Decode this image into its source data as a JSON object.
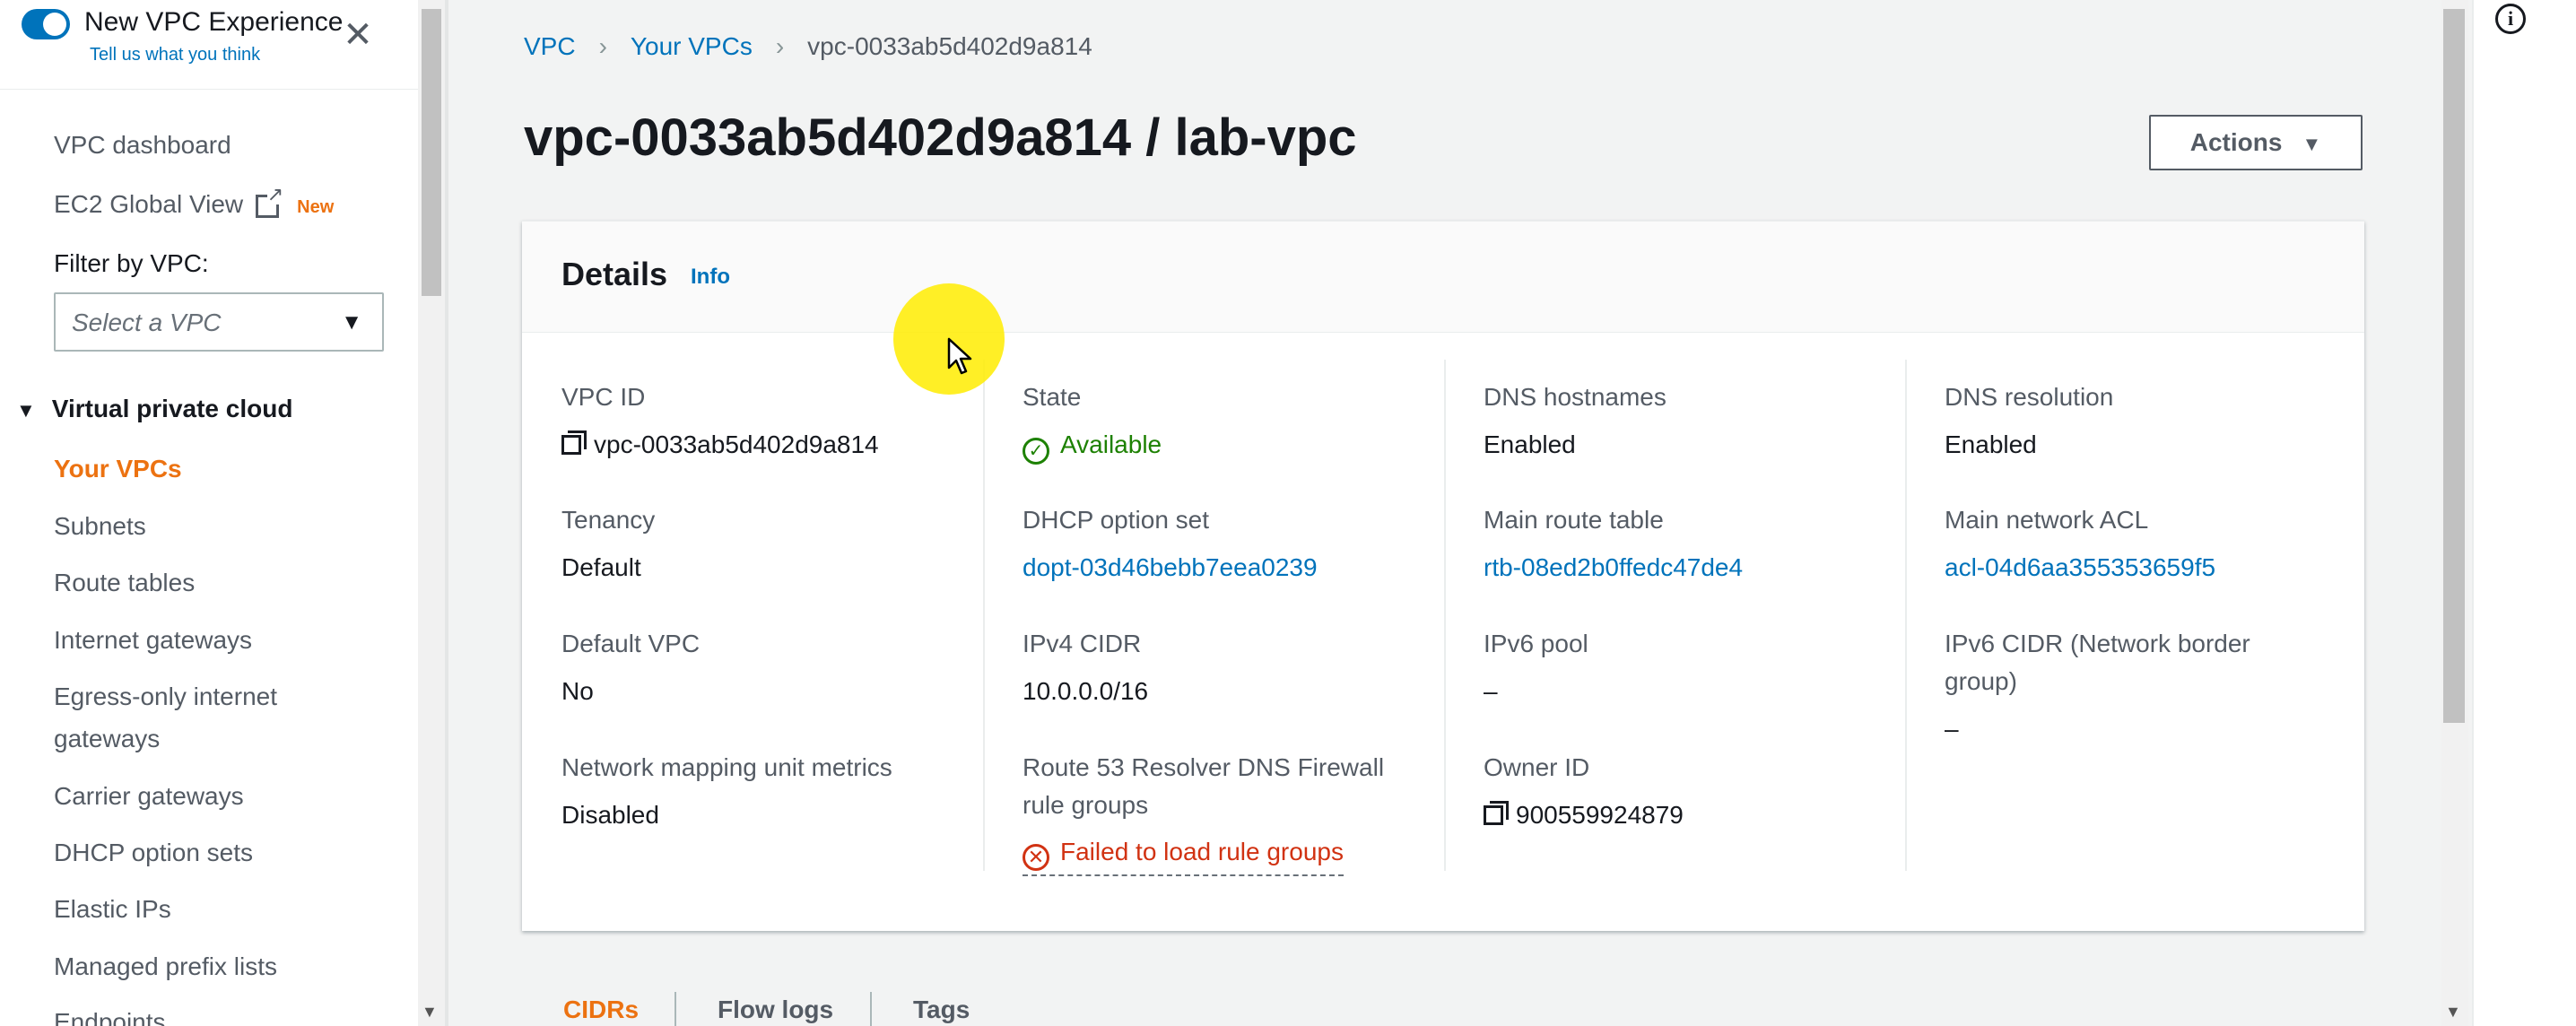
{
  "sidebar": {
    "experience_title": "New VPC Experience",
    "experience_sub": "Tell us what you think",
    "links": [
      {
        "label": "VPC dashboard"
      },
      {
        "label": "EC2 Global View",
        "badge": "New"
      }
    ],
    "filter_label": "Filter by VPC:",
    "filter_placeholder": "Select a VPC",
    "section": "Virtual private cloud",
    "items": [
      "Your VPCs",
      "Subnets",
      "Route tables",
      "Internet gateways",
      "Egress-only internet",
      "gateways",
      "Carrier gateways",
      "DHCP option sets",
      "Elastic IPs",
      "Managed prefix lists",
      "Endpoints"
    ]
  },
  "breadcrumb": [
    "VPC",
    "Your VPCs",
    "vpc-0033ab5d402d9a814"
  ],
  "page_title": "vpc-0033ab5d402d9a814 / lab-vpc",
  "actions_label": "Actions",
  "details": {
    "title": "Details",
    "info": "Info",
    "columns": [
      [
        {
          "label": "VPC ID",
          "value": "vpc-0033ab5d402d9a814"
        },
        {
          "label": "Tenancy",
          "value": "Default"
        },
        {
          "label": "Default VPC",
          "value": "No"
        },
        {
          "label": "Network mapping unit metrics",
          "value": "Disabled"
        }
      ],
      [
        {
          "label": "State",
          "value": "Available"
        },
        {
          "label": "DHCP option set",
          "value": "dopt-03d46bebb7eea0239"
        },
        {
          "label": "IPv4 CIDR",
          "value": "10.0.0.0/16"
        },
        {
          "label_line1": "Route 53 Resolver DNS Firewall",
          "label_line2": "rule groups",
          "value": "Failed to load rule groups"
        }
      ],
      [
        {
          "label": "DNS hostnames",
          "value": "Enabled"
        },
        {
          "label": "Main route table",
          "value": "rtb-08ed2b0ffedc47de4"
        },
        {
          "label": "IPv6 pool",
          "value": "–"
        },
        {
          "label": "Owner ID",
          "value": "900559924879"
        }
      ],
      [
        {
          "label": "DNS resolution",
          "value": "Enabled"
        },
        {
          "label": "Main network ACL",
          "value": "acl-04d6aa355353659f5"
        },
        {
          "label_line1": "IPv6 CIDR (Network border",
          "label_line2": "group)",
          "value": "–"
        }
      ]
    ]
  },
  "tabs": [
    "CIDRs",
    "Flow logs",
    "Tags"
  ],
  "colors": {
    "accent": "#ec7211",
    "link": "#0073bb",
    "success": "#1d8102",
    "error": "#d13212"
  }
}
